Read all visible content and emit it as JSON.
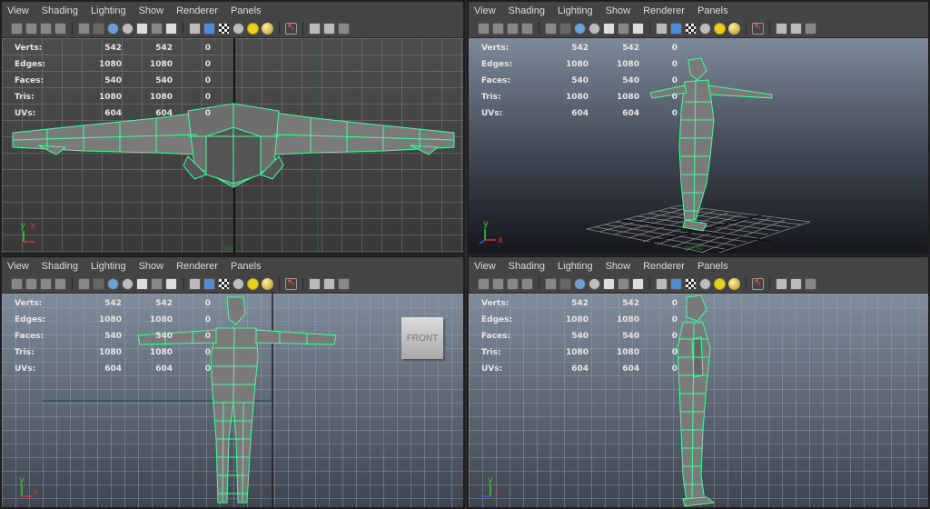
{
  "menus": [
    "View",
    "Shading",
    "Lighting",
    "Show",
    "Renderer",
    "Panels"
  ],
  "hud": {
    "labels": [
      "Verts:",
      "Edges:",
      "Faces:",
      "Tris:",
      "UVs:"
    ],
    "col1": [
      "542",
      "1080",
      "540",
      "1080",
      "604"
    ],
    "col2": [
      "542",
      "1080",
      "540",
      "1080",
      "604"
    ],
    "col3": [
      "0",
      "0",
      "0",
      "0",
      "0"
    ]
  },
  "axis": {
    "y": "y",
    "x": "x",
    "z": "z"
  },
  "cameras": {
    "top": "top",
    "persp": "persp",
    "front": "front"
  },
  "viewcube_label": "FRONT",
  "colors": {
    "wire": "#40ff9a",
    "mesh": "#7e7e7e",
    "grid": "#8a8a8a",
    "axis_red": "#e03030",
    "axis_green": "#30d030"
  }
}
